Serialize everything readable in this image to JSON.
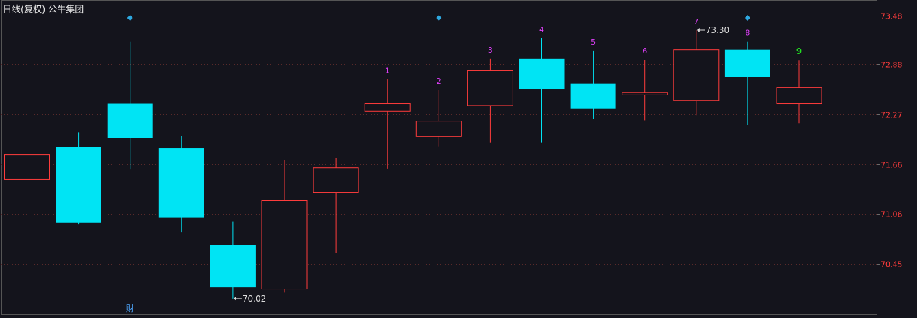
{
  "header": {
    "title": "日线(复权) 公牛集团"
  },
  "colors": {
    "background": "#14141c",
    "up": "#ff3c3c",
    "down": "#00e4f4",
    "grid": "#5a2a2a",
    "axis_text": "#ff3c3c",
    "count_label": "#e040fb",
    "count_final": "#22dd22",
    "marker": "#2ea8e0",
    "annotation": "#dcdcdc",
    "fin_marker": "#4fa8ff"
  },
  "chart_data": {
    "type": "candlestick",
    "y_ticks": [
      "73.48",
      "72.88",
      "72.27",
      "71.66",
      "71.06",
      "70.45"
    ],
    "ylim": [
      69.92,
      73.5
    ],
    "grid": true,
    "candles": [
      {
        "open": 71.48,
        "close": 71.78,
        "high": 72.16,
        "low": 71.36
      },
      {
        "open": 71.87,
        "close": 70.95,
        "high": 72.05,
        "low": 70.93
      },
      {
        "open": 72.4,
        "close": 71.98,
        "high": 73.16,
        "low": 71.6,
        "marker": true
      },
      {
        "open": 71.86,
        "close": 71.01,
        "high": 72.01,
        "low": 70.83
      },
      {
        "open": 70.68,
        "close": 70.16,
        "high": 70.96,
        "low": 70.02
      },
      {
        "open": 70.14,
        "close": 71.22,
        "high": 71.71,
        "low": 70.1
      },
      {
        "open": 71.32,
        "close": 71.62,
        "high": 71.74,
        "low": 70.58
      },
      {
        "open": 72.31,
        "close": 72.4,
        "high": 72.7,
        "low": 71.61,
        "count": "1"
      },
      {
        "open": 72.0,
        "close": 72.19,
        "high": 72.57,
        "low": 71.88,
        "count": "2"
      },
      {
        "open": 72.38,
        "close": 72.81,
        "high": 72.95,
        "low": 71.93,
        "count": "3"
      },
      {
        "open": 72.95,
        "close": 72.58,
        "high": 73.2,
        "low": 71.93,
        "count": "4"
      },
      {
        "open": 72.65,
        "close": 72.34,
        "high": 73.05,
        "low": 72.22,
        "count": "5"
      },
      {
        "open": 72.51,
        "close": 72.54,
        "high": 72.94,
        "low": 72.2,
        "count": "6"
      },
      {
        "open": 72.44,
        "close": 73.06,
        "high": 73.3,
        "low": 72.26,
        "count": "7"
      },
      {
        "open": 73.06,
        "close": 72.73,
        "high": 73.16,
        "low": 72.14,
        "count": "8",
        "marker": true
      },
      {
        "open": 72.4,
        "close": 72.6,
        "high": 72.93,
        "low": 72.16,
        "count": "9",
        "final": true
      }
    ],
    "extra_markers": [
      8
    ],
    "annotations": [
      {
        "candle": 4,
        "value": 70.02,
        "text": "70.02",
        "arrow": "←"
      },
      {
        "candle": 13,
        "value": 73.3,
        "text": "73.30",
        "arrow": "←"
      }
    ],
    "fin_label": {
      "candle": 2,
      "text": "财"
    }
  }
}
